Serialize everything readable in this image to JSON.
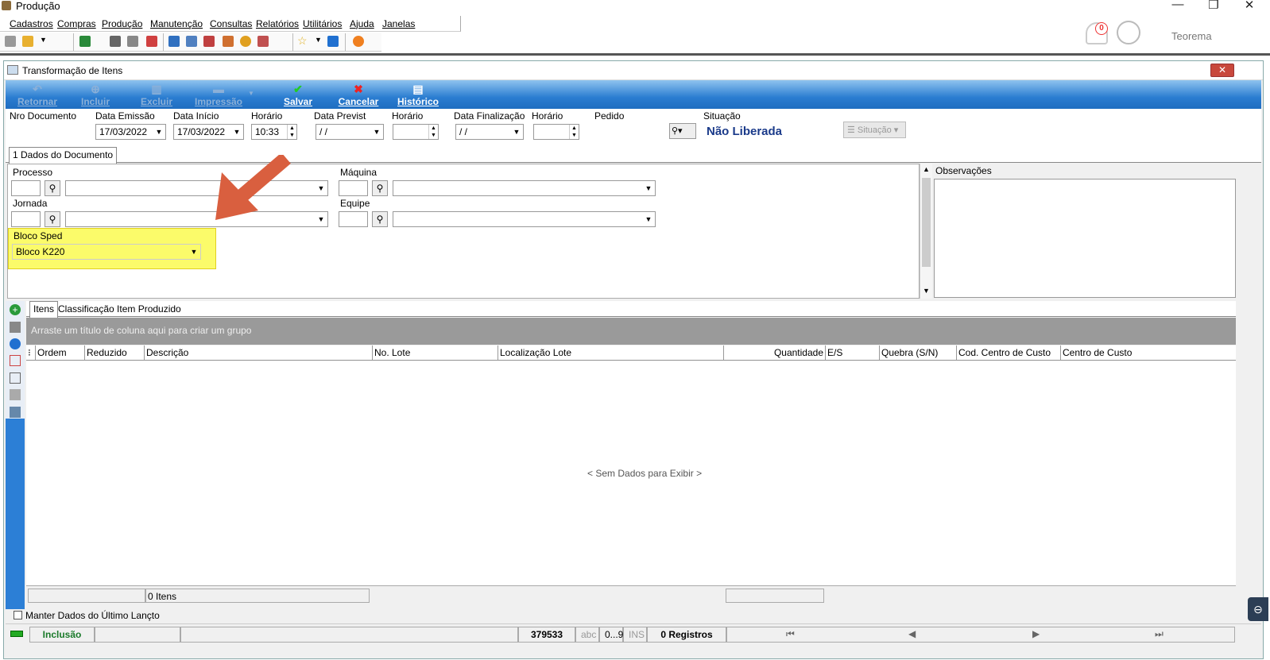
{
  "app": {
    "title": "Produção",
    "user": "Teorema",
    "notifications": "0"
  },
  "menu": [
    "Cadastros",
    "Compras",
    "Produção",
    "Manutenção",
    "Consultas",
    "Relatórios",
    "Utilitários",
    "Ajuda",
    "Janelas"
  ],
  "window": {
    "title": "Transformação de Itens"
  },
  "ribbon": {
    "retornar": "Retornar",
    "incluir": "Incluir",
    "excluir": "Excluir",
    "impressao": "Impressão",
    "salvar": "Salvar",
    "cancelar": "Cancelar",
    "historico": "Histórico"
  },
  "header": {
    "nro_documento_label": "Nro Documento",
    "data_emissao_label": "Data Emissão",
    "data_emissao": "17/03/2022",
    "data_inicio_label": "Data Início",
    "data_inicio": "17/03/2022",
    "horario_label": "Horário",
    "horario": "10:33",
    "data_previst_label": "Data Previst",
    "data_previst": " / /",
    "horario2_label": "Horário",
    "data_finalizacao_label": "Data Finalização",
    "data_finalizacao": " / /",
    "horario3_label": "Horário",
    "pedido_label": "Pedido",
    "situacao_label": "Situação",
    "situacao": "Não Liberada",
    "situacao_button": "Situação"
  },
  "doc_tab": "1 Dados do Documento",
  "form": {
    "processo": "Processo",
    "maquina": "Máquina",
    "jornada": "Jornada",
    "equipe": "Equipe",
    "bloco_sped_label": "Bloco Sped",
    "bloco_sped": "Bloco K220",
    "observacoes": "Observações"
  },
  "item_tabs": [
    "Itens",
    "Classificação Item Produzido"
  ],
  "grid": {
    "group_hint": "Arraste um título de coluna aqui para criar um grupo",
    "columns": [
      "Ordem",
      "Reduzido",
      "Descrição",
      "No. Lote",
      "Localização Lote",
      "Quantidade",
      "E/S",
      "Quebra (S/N)",
      "Cod. Centro de Custo",
      "Centro de Custo"
    ],
    "empty": "< Sem Dados para Exibir >",
    "footer": "0 Itens"
  },
  "manter": "Manter Dados do Último Lançto",
  "status": {
    "mode": "Inclusão",
    "code": "379533",
    "abc": "abc",
    "num": "0...9",
    "ins": "INS",
    "registros": "0 Registros"
  }
}
